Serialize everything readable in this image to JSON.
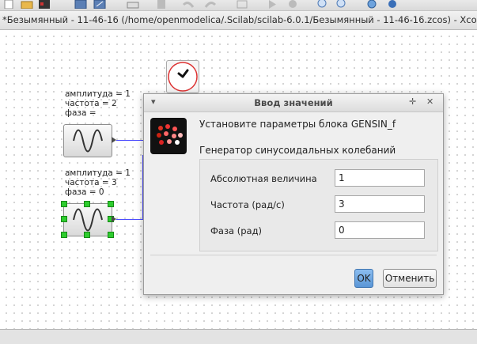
{
  "window": {
    "title": "*Безымянный - 11-46-16 (/home/openmodelica/.Scilab/scilab-6.0.1/Безымянный - 11-46-16.zcos) - Xcos"
  },
  "toolbar": {
    "icons": [
      "new-icon",
      "open-icon",
      "image-icon",
      "save-icon",
      "save-as-icon",
      "print-icon",
      "delete-icon",
      "undo-icon",
      "redo-icon",
      "fit-icon",
      "start-icon",
      "stop-icon",
      "zoom-in-icon",
      "zoom-out-icon",
      "browser-icon",
      "help-icon"
    ]
  },
  "diagram": {
    "block1": {
      "params": "амплитуда = 1\nчастота = 2\nфаза = "
    },
    "block2": {
      "params": "амплитуда = 1\nчастота = 3\nфаза = 0"
    }
  },
  "dialog": {
    "title": "Ввод значений",
    "heading": "Установите параметры блока GENSIN_f",
    "subheading": "Генератор синусоидальных колебаний",
    "fields": [
      {
        "label": "Абсолютная величина",
        "value": "1"
      },
      {
        "label": "Частота (рад/с)",
        "value": "3"
      },
      {
        "label": "Фаза (рад)",
        "value": "0"
      }
    ],
    "ok_label": "OK",
    "cancel_label": "Отменить"
  },
  "colors": {
    "wire": "#4c4cff",
    "selection": "#2ecc2e",
    "ok_button": "#5a96d6"
  }
}
